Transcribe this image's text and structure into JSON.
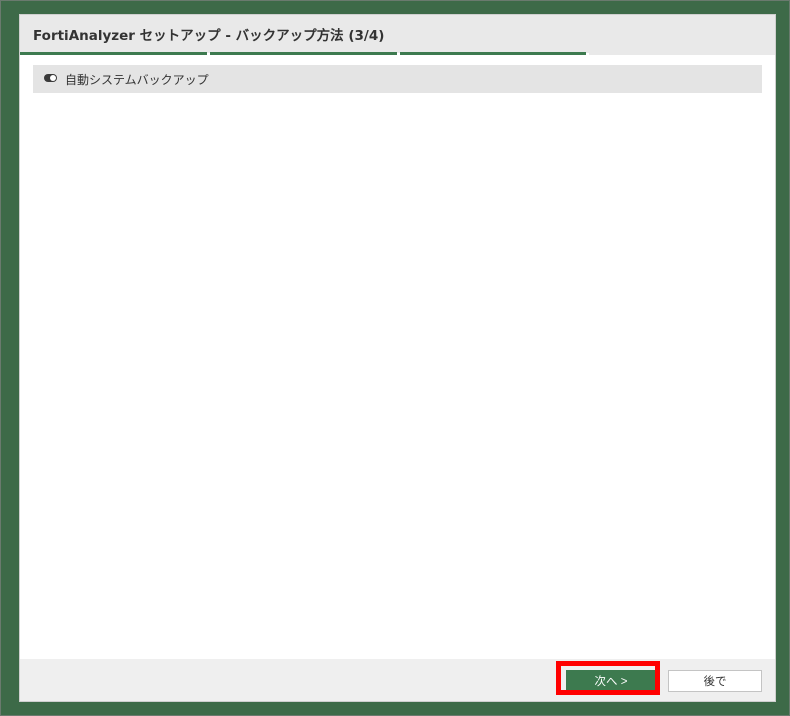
{
  "dialog": {
    "title": "FortiAnalyzer セットアップ - バックアップ方法 (3/4)",
    "progress": {
      "current_step": 3,
      "total_steps": 4
    }
  },
  "options": {
    "auto_backup_label": "自動システムバックアップ",
    "auto_backup_enabled": true
  },
  "footer": {
    "next_label": "次へ >",
    "later_label": "後で"
  },
  "colors": {
    "frame": "#3d6a48",
    "accent": "#3d7a4f",
    "highlight": "#ff0000"
  }
}
